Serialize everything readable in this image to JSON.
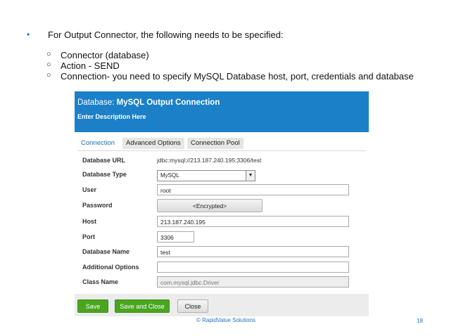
{
  "slide": {
    "bullet": "For Output Connector, the following needs to be specified:",
    "bullet_symbol": "•",
    "sub_symbol": "○",
    "sub_items": [
      "Connector (database)",
      "Action - SEND",
      "Connection- you need to specify MySQL Database host, port, credentials and database"
    ],
    "copyright": "© RapidValue Solutions",
    "page_number": "18"
  },
  "dialog": {
    "title_prefix": "Database: ",
    "title_name": "MySQL Output Connection",
    "description": "Enter Description Here",
    "tabs": [
      "Connection",
      "Advanced Options",
      "Connection Pool"
    ],
    "active_tab": "Connection",
    "fields": {
      "database_url": {
        "label": "Database URL",
        "value": "jdbc:mysql://213.187.240.195:3306/test"
      },
      "database_type": {
        "label": "Database Type",
        "value": "MySQL"
      },
      "user": {
        "label": "User",
        "value": "root"
      },
      "password": {
        "label": "Password",
        "value": "<Encrypted>"
      },
      "host": {
        "label": "Host",
        "value": "213.187.240.195"
      },
      "port": {
        "label": "Port",
        "value": "3306"
      },
      "database_name": {
        "label": "Database Name",
        "value": "test"
      },
      "additional_options": {
        "label": "Additional Options",
        "value": ""
      },
      "class_name": {
        "label": "Class Name",
        "value": "com.mysql.jdbc.Driver"
      }
    },
    "buttons": {
      "save": "Save",
      "save_and_close": "Save and Close",
      "close": "Close"
    },
    "colors": {
      "header": "#1b80c8",
      "green_button": "#4aa51f",
      "accent_text": "#1f6fbf"
    }
  }
}
